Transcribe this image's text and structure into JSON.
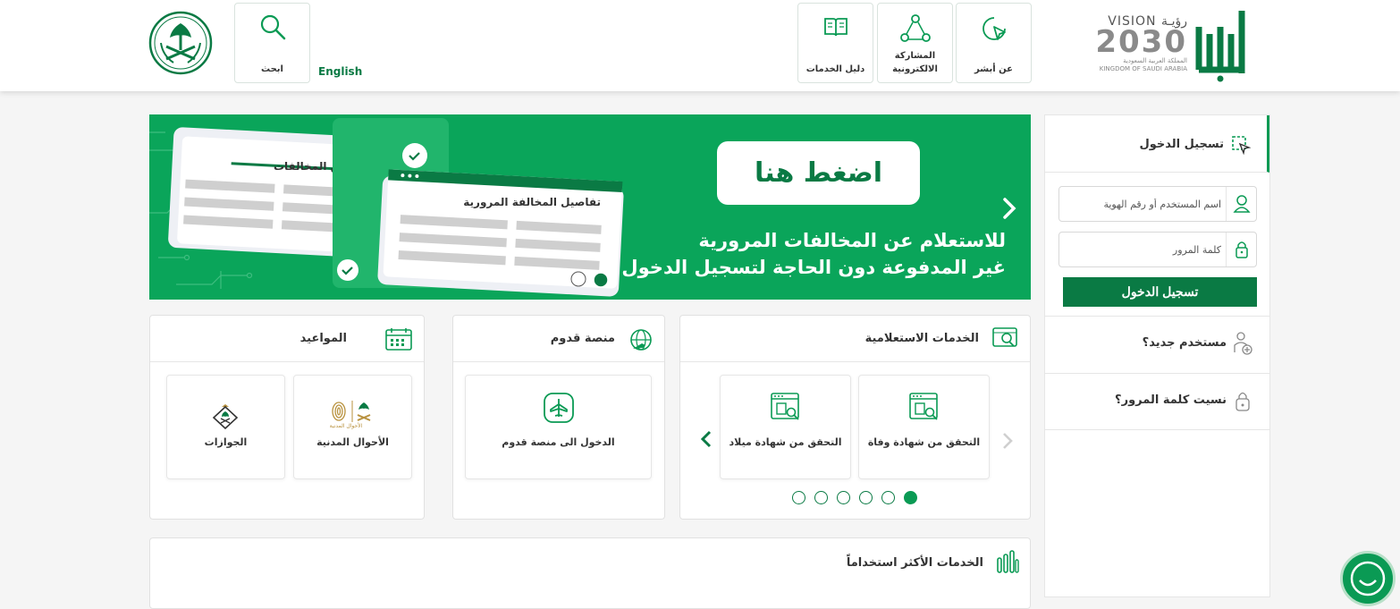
{
  "header": {
    "nav": [
      {
        "label": "عن أبشر",
        "icon": "cursor-click-icon"
      },
      {
        "label": "المشاركة الالكترونية",
        "icon": "network-icon"
      },
      {
        "label": "دليل الخدمات",
        "icon": "open-book-icon"
      }
    ],
    "search_label": "ابحث",
    "language_link": "English",
    "vision": {
      "top": "VISION رؤيـة",
      "year": "2030",
      "ar": "المملكة العربية السعودية",
      "en": "KINGDOM OF SAUDI ARABIA"
    }
  },
  "banner": {
    "cta": "اضغط هنا",
    "line1": "للاستعلام عن المخالفات المرورية",
    "line2": "غير المدفوعة دون الحاجة لتسجيل الدخول",
    "card1_title": "ملخص المخالفات",
    "card2_title": "تفاصيل المخالفة المرورية"
  },
  "inquiry": {
    "title": "الخدمات الاستعلامية",
    "tiles": [
      "التحقق من شهادة وفاة",
      "التحقق من شهادة ميلاد"
    ],
    "active_page": 1,
    "page_count": 6
  },
  "qudoom": {
    "title": "منصة قدوم",
    "tile": "الدخول الى منصة قدوم"
  },
  "appointments": {
    "title": "المواعيد",
    "tiles": [
      {
        "label": "الأحوال المدنية",
        "logo_text": "الأحوال المدنية"
      },
      {
        "label": "الجوازات"
      }
    ]
  },
  "most_used": {
    "title": "الخدمات الأكثر استخداماً"
  },
  "login": {
    "title": "تسجيل الدخول",
    "username_placeholder": "اسم المستخدم أو رقم الهوية",
    "password_placeholder": "كلمة المرور",
    "submit": "تسجيل الدخول",
    "new_user": "مستخدم جديد؟",
    "forgot": "نسيت كلمة المرور؟"
  },
  "colors": {
    "brand_green": "#0a7a44",
    "banner_green": "#0aa55a",
    "accent": "#0a9a54"
  }
}
